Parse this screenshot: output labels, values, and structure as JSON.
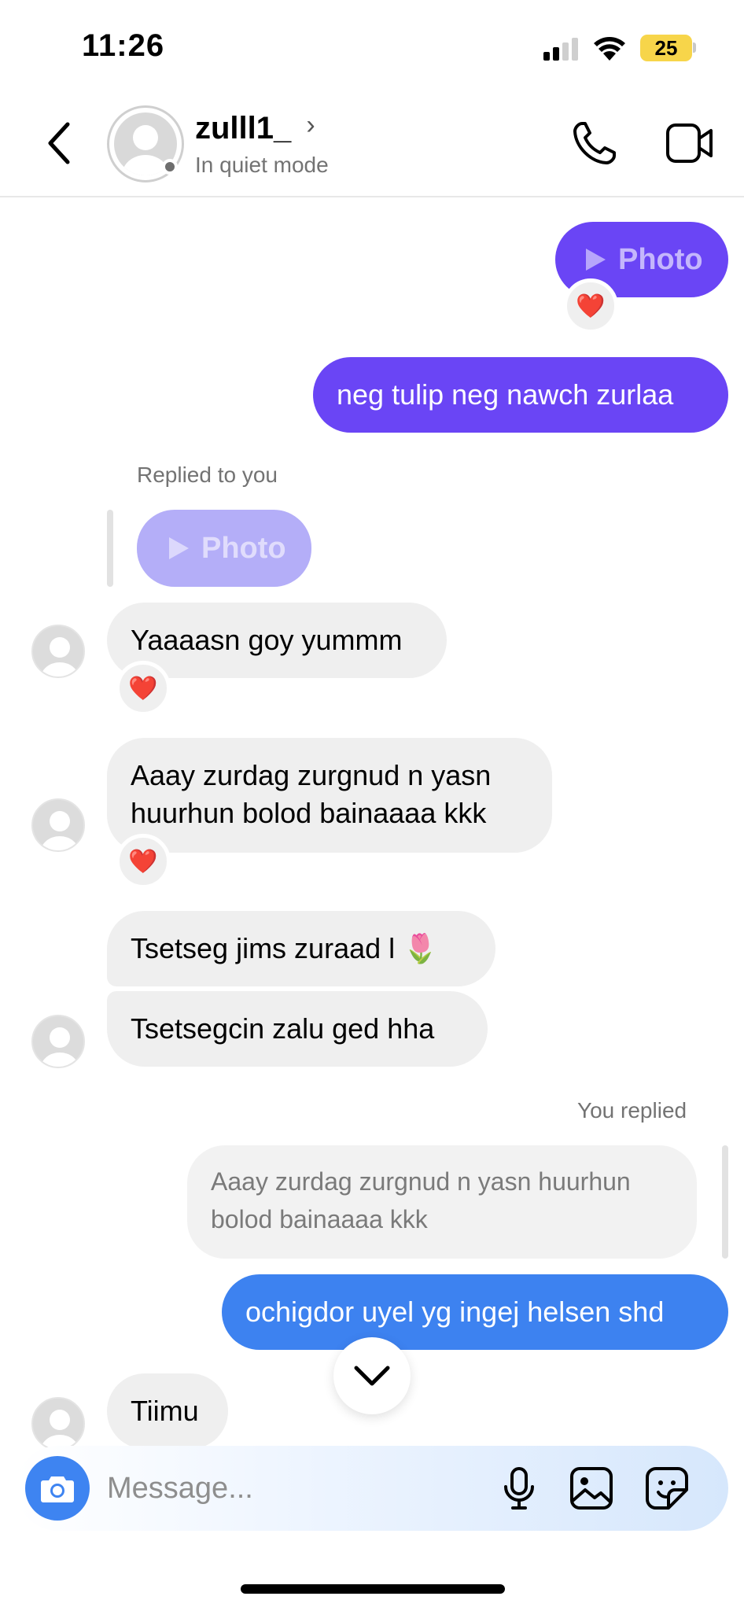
{
  "status_bar": {
    "time": "11:26",
    "battery": "25"
  },
  "header": {
    "username": "zulll1_",
    "chevron": "›",
    "subtitle": "In quiet mode"
  },
  "messages": {
    "photo_sent_label": "Photo",
    "msg_sent_1": "neg tulip neg nawch zurlaa",
    "replied_label": "Replied to you",
    "reply_photo_label": "Photo",
    "msg_in_1": "Yaaaasn goy yummm",
    "msg_in_2_line1": "Aaay zurdag zurgnud n yasn",
    "msg_in_2_line2": "huurhun bolod bainaaaa kkk",
    "msg_in_3": "Tsetseg jims zuraad l 🌷",
    "msg_in_4": "Tsetsegcin zalu ged hha",
    "you_replied_label": "You replied",
    "quoted_line1": "Aaay zurdag zurgnud n yasn huurhun",
    "quoted_line2": "bolod bainaaaa kkk",
    "msg_sent_2": "ochigdor uyel yg ingej helsen shd",
    "msg_in_5": "Tiimu",
    "reaction": "❤️"
  },
  "composer": {
    "placeholder": "Message..."
  },
  "colors": {
    "purple": "#6a45f5",
    "blue": "#3d82f0",
    "grey_bubble": "#efefef",
    "camera": "#3e84f1"
  }
}
